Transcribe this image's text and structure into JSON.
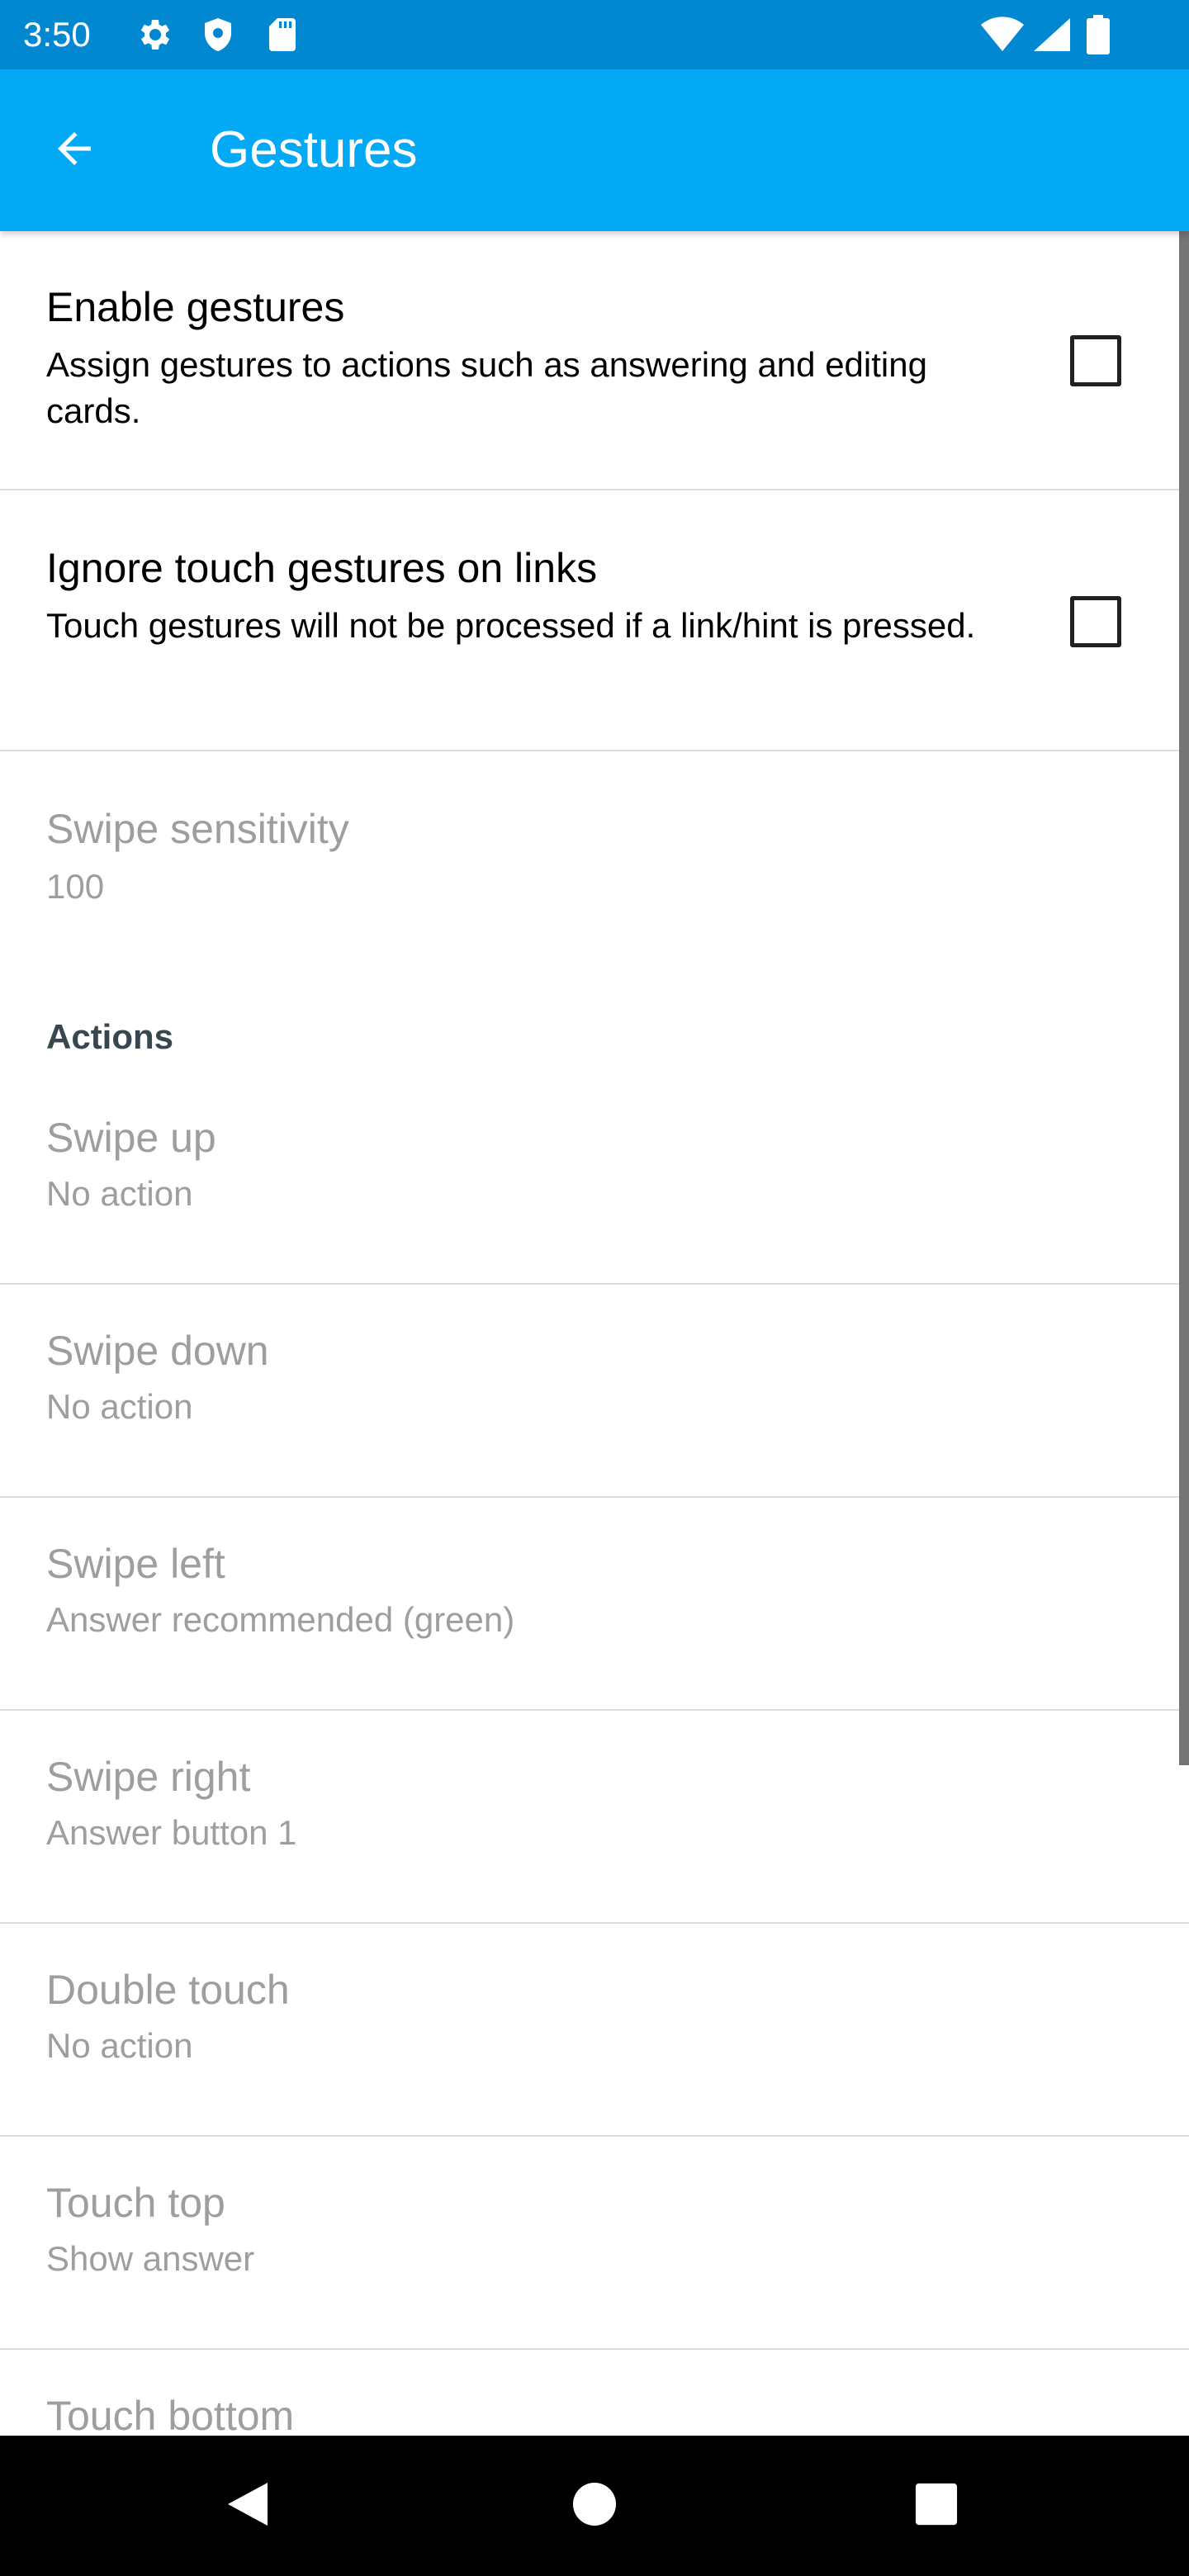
{
  "status_bar": {
    "time": "3:50",
    "icons_left": [
      "gear-icon",
      "shield-icon",
      "sd-card-icon"
    ],
    "icons_right": [
      "wifi-icon",
      "signal-icon",
      "battery-icon"
    ],
    "color": "#0288d1"
  },
  "app_bar": {
    "title": "Gestures",
    "back_icon": "arrow-back-icon",
    "color": "#03a9f4"
  },
  "preferences": {
    "enable_gestures": {
      "title": "Enable gestures",
      "summary": "Assign gestures to actions such as answering and editing cards.",
      "checked": false
    },
    "ignore_links": {
      "title": "Ignore touch gestures on links",
      "summary": "Touch gestures will not be processed if a link/hint is pressed.",
      "checked": false
    },
    "swipe_sensitivity": {
      "title": "Swipe sensitivity",
      "value": "100"
    }
  },
  "actions": {
    "header": "Actions",
    "items": [
      {
        "title": "Swipe up",
        "value": "No action"
      },
      {
        "title": "Swipe down",
        "value": "No action"
      },
      {
        "title": "Swipe left",
        "value": "Answer recommended (green)"
      },
      {
        "title": "Swipe right",
        "value": "Answer button 1"
      },
      {
        "title": "Double touch",
        "value": "No action"
      },
      {
        "title": "Touch top",
        "value": "Show answer"
      },
      {
        "title": "Touch bottom",
        "value": ""
      }
    ]
  },
  "nav_bar": {
    "icons": [
      "back-triangle-icon",
      "home-circle-icon",
      "recents-square-icon"
    ]
  }
}
